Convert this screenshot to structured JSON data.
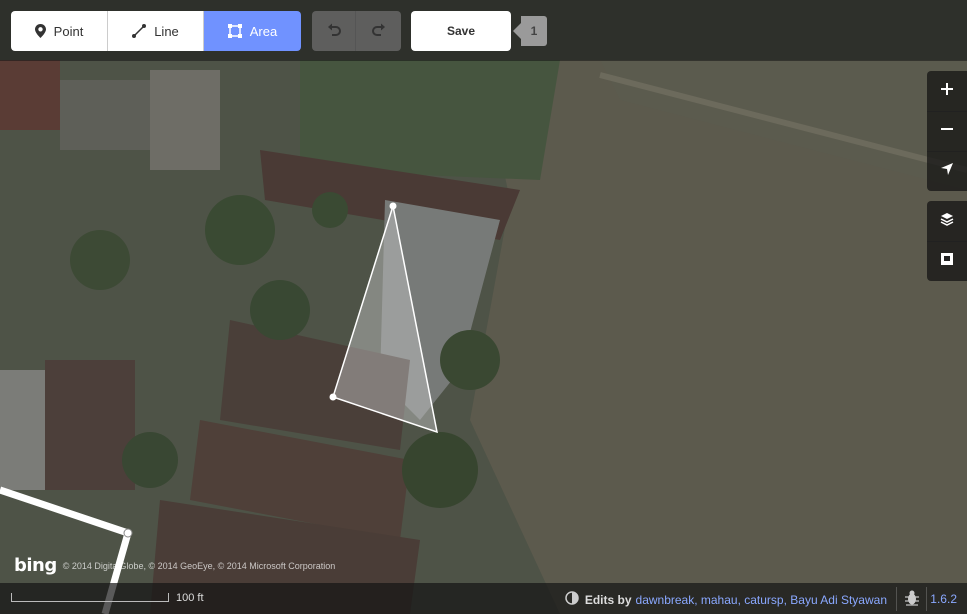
{
  "toolbar": {
    "point_label": "Point",
    "line_label": "Line",
    "area_label": "Area",
    "save_label": "Save",
    "edit_count": "1",
    "active_mode_color": "#7092ff"
  },
  "map": {
    "zoom_in_icon": "plus-icon",
    "zoom_out_icon": "minus-icon",
    "geolocate_icon": "location-arrow-icon",
    "layers_icon": "layers-icon",
    "map_data_icon": "map-data-icon"
  },
  "attribution": {
    "logo": "bing",
    "text": "© 2014 DigitalGlobe, © 2014 GeoEye, © 2014 Microsoft Corporation"
  },
  "footer": {
    "scale_label": "100 ft",
    "edits_by_label": "Edits by",
    "contributors": "dawnbreak, mahau, catursp, Bayu Adi Styawan",
    "version": "1.6.2"
  }
}
